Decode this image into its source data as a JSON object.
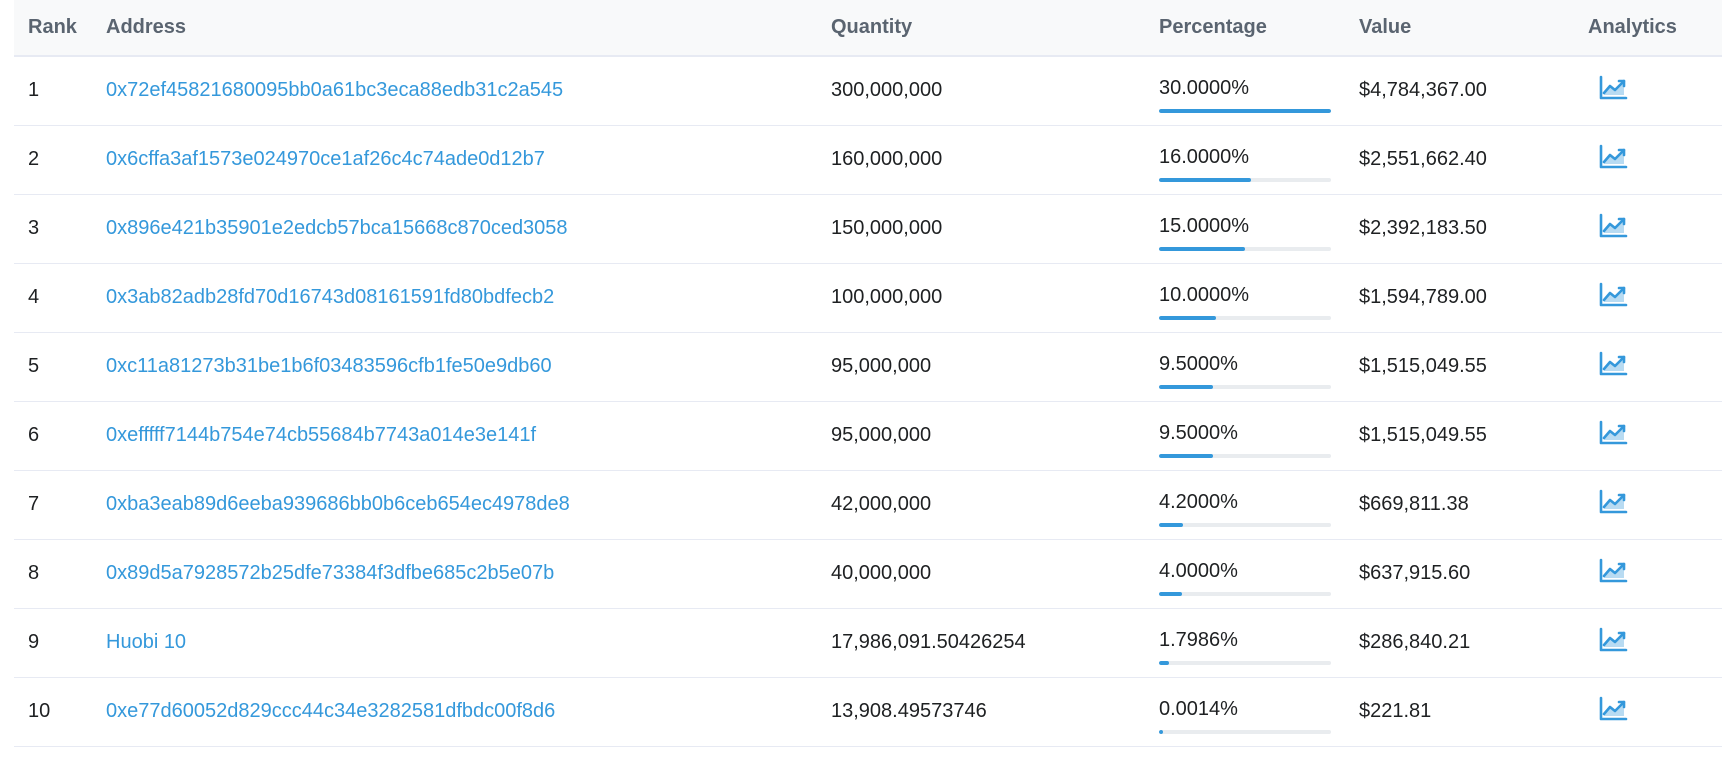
{
  "table": {
    "headers": {
      "rank": "Rank",
      "address": "Address",
      "quantity": "Quantity",
      "percentage": "Percentage",
      "value": "Value",
      "analytics": "Analytics"
    },
    "accent_color": "#3498db",
    "analytics_icon": "area-chart-icon",
    "rows": [
      {
        "rank": "1",
        "address": "0x72ef45821680095bb0a61bc3eca88edb31c2a545",
        "quantity": "300,000,000",
        "percentage": "30.0000%",
        "percent_value": 30.0,
        "value": "$4,784,367.00"
      },
      {
        "rank": "2",
        "address": "0x6cffa3af1573e024970ce1af26c4c74ade0d12b7",
        "quantity": "160,000,000",
        "percentage": "16.0000%",
        "percent_value": 16.0,
        "value": "$2,551,662.40"
      },
      {
        "rank": "3",
        "address": "0x896e421b35901e2edcb57bca15668c870ced3058",
        "quantity": "150,000,000",
        "percentage": "15.0000%",
        "percent_value": 15.0,
        "value": "$2,392,183.50"
      },
      {
        "rank": "4",
        "address": "0x3ab82adb28fd70d16743d08161591fd80bdfecb2",
        "quantity": "100,000,000",
        "percentage": "10.0000%",
        "percent_value": 10.0,
        "value": "$1,594,789.00"
      },
      {
        "rank": "5",
        "address": "0xc11a81273b31be1b6f03483596cfb1fe50e9db60",
        "quantity": "95,000,000",
        "percentage": "9.5000%",
        "percent_value": 9.5,
        "value": "$1,515,049.55"
      },
      {
        "rank": "6",
        "address": "0xefffff7144b754e74cb55684b7743a014e3e141f",
        "quantity": "95,000,000",
        "percentage": "9.5000%",
        "percent_value": 9.5,
        "value": "$1,515,049.55"
      },
      {
        "rank": "7",
        "address": "0xba3eab89d6eeba939686bb0b6ceb654ec4978de8",
        "quantity": "42,000,000",
        "percentage": "4.2000%",
        "percent_value": 4.2,
        "value": "$669,811.38"
      },
      {
        "rank": "8",
        "address": "0x89d5a7928572b25dfe73384f3dfbe685c2b5e07b",
        "quantity": "40,000,000",
        "percentage": "4.0000%",
        "percent_value": 4.0,
        "value": "$637,915.60"
      },
      {
        "rank": "9",
        "address": "Huobi 10",
        "quantity": "17,986,091.50426254",
        "percentage": "1.7986%",
        "percent_value": 1.7986,
        "value": "$286,840.21"
      },
      {
        "rank": "10",
        "address": "0xe77d60052d829ccc44c34e3282581dfbdc00f8d6",
        "quantity": "13,908.49573746",
        "percentage": "0.0014%",
        "percent_value": 0.0014,
        "value": "$221.81"
      }
    ]
  }
}
